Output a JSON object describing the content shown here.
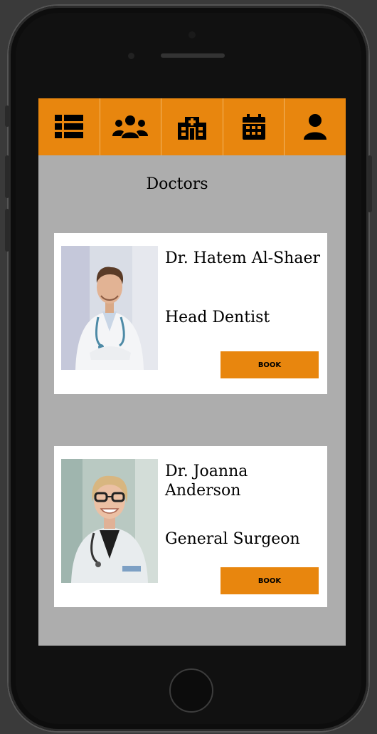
{
  "app": {
    "page_title": "Doctors"
  },
  "nav": {
    "items": [
      {
        "icon": "list-icon"
      },
      {
        "icon": "users-icon"
      },
      {
        "icon": "hospital-icon"
      },
      {
        "icon": "calendar-icon"
      },
      {
        "icon": "user-icon"
      }
    ]
  },
  "doctors": [
    {
      "name": "Dr. Hatem Al-Shaer",
      "role": "Head Dentist",
      "book_label": "BOOK"
    },
    {
      "name": "Dr. Joanna Anderson",
      "role": "General Surgeon",
      "book_label": "BOOK"
    }
  ],
  "colors": {
    "accent": "#e8860e",
    "screen_bg": "#adadad",
    "card_bg": "#ffffff"
  }
}
